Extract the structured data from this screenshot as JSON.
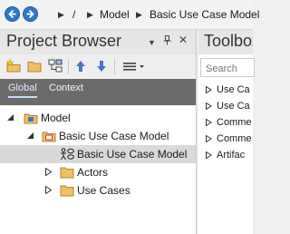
{
  "breadcrumb": {
    "root_sep": "/",
    "items": [
      "Model",
      "Basic Use Case Model"
    ],
    "sep": "▶"
  },
  "project_browser": {
    "title": "Project Browser",
    "controls": {
      "menu": "▼",
      "pin": "⊥",
      "close": "✕"
    },
    "tabs": [
      "Global",
      "Context"
    ],
    "active_tab": "Global",
    "tree": [
      {
        "label": "Model",
        "icon": "model-package-icon",
        "expander": "expanded"
      },
      {
        "label": "Basic Use Case Model",
        "icon": "package-icon",
        "expander": "expanded"
      },
      {
        "label": "Basic Use Case Model",
        "icon": "use-case-diagram-icon",
        "expander": "none",
        "selected": true
      },
      {
        "label": "Actors",
        "icon": "folder-icon",
        "expander": "collapsed"
      },
      {
        "label": "Use Cases",
        "icon": "folder-icon",
        "expander": "collapsed"
      }
    ]
  },
  "toolbox": {
    "title": "Toolbox",
    "search_placeholder": "Search",
    "items": [
      "Use Ca",
      "Use Ca",
      "Comme",
      "Comme",
      "Artifac"
    ]
  },
  "colors": {
    "nav_blue": "#2f78c8",
    "tab_bar": "#6b6b6b",
    "selection": "#d9d9d9",
    "folder": "#f2c062"
  }
}
